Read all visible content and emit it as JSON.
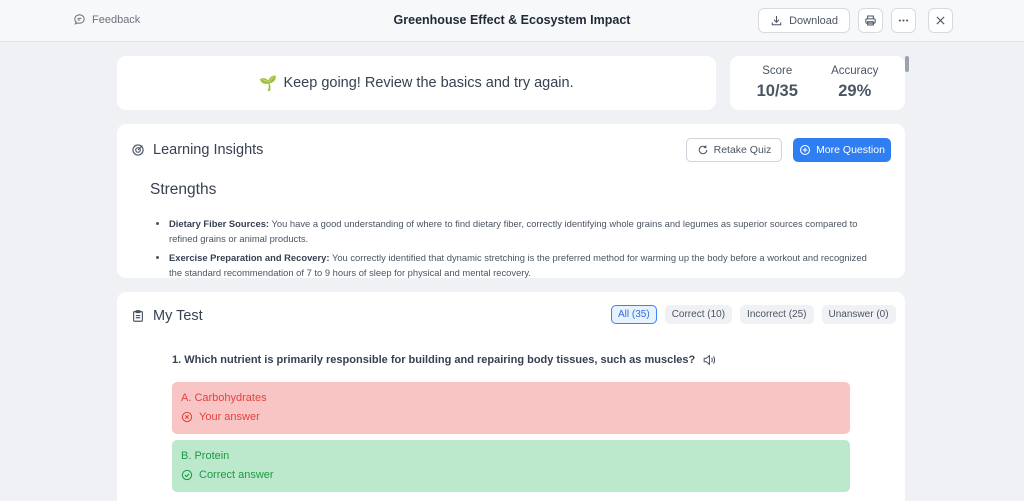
{
  "header": {
    "feedback_label": "Feedback",
    "title": "Greenhouse Effect & Ecosystem Impact",
    "download_label": "Download",
    "icons": [
      "chat-bubble-icon",
      "download-icon",
      "printer-icon",
      "more-icon",
      "close-icon"
    ]
  },
  "banner": {
    "emoji": "🌱",
    "message": "Keep going! Review the basics and try again."
  },
  "stats": {
    "score_label": "Score",
    "score_value": "10/35",
    "accuracy_label": "Accuracy",
    "accuracy_value": "29%"
  },
  "insights": {
    "title": "Learning Insights",
    "retake_label": "Retake Quiz",
    "more_label": "More Question",
    "strengths_title": "Strengths",
    "strengths": [
      {
        "heading": "Dietary Fiber Sources:",
        "text": "You have a good understanding of where to find dietary fiber, correctly identifying whole grains and legumes as superior sources compared to refined grains or animal products."
      },
      {
        "heading": "Exercise Preparation and Recovery:",
        "text": "You correctly identified that dynamic stretching is the preferred method for warming up the body before a workout and recognized the standard recommendation of 7 to 9 hours of sleep for physical and mental recovery."
      }
    ]
  },
  "mytest": {
    "title": "My Test",
    "filters": [
      {
        "label": "All (35)",
        "active": true
      },
      {
        "label": "Correct (10)",
        "active": false
      },
      {
        "label": "Incorrect (25)",
        "active": false
      },
      {
        "label": "Unanswer (0)",
        "active": false
      }
    ],
    "question": "1.  Which nutrient is primarily responsible for building and repairing body tissues, such as muscles?",
    "options": [
      {
        "label": "A. Carbohydrates",
        "status": "Your answer"
      },
      {
        "label": "B. Protein",
        "status": "Correct answer"
      }
    ]
  },
  "colors": {
    "accent": "#2f7ff2",
    "wrong_bg": "#f8c5c4",
    "wrong_text": "#e2423f",
    "right_bg": "#bce9cb",
    "right_text": "#1c9a45"
  }
}
